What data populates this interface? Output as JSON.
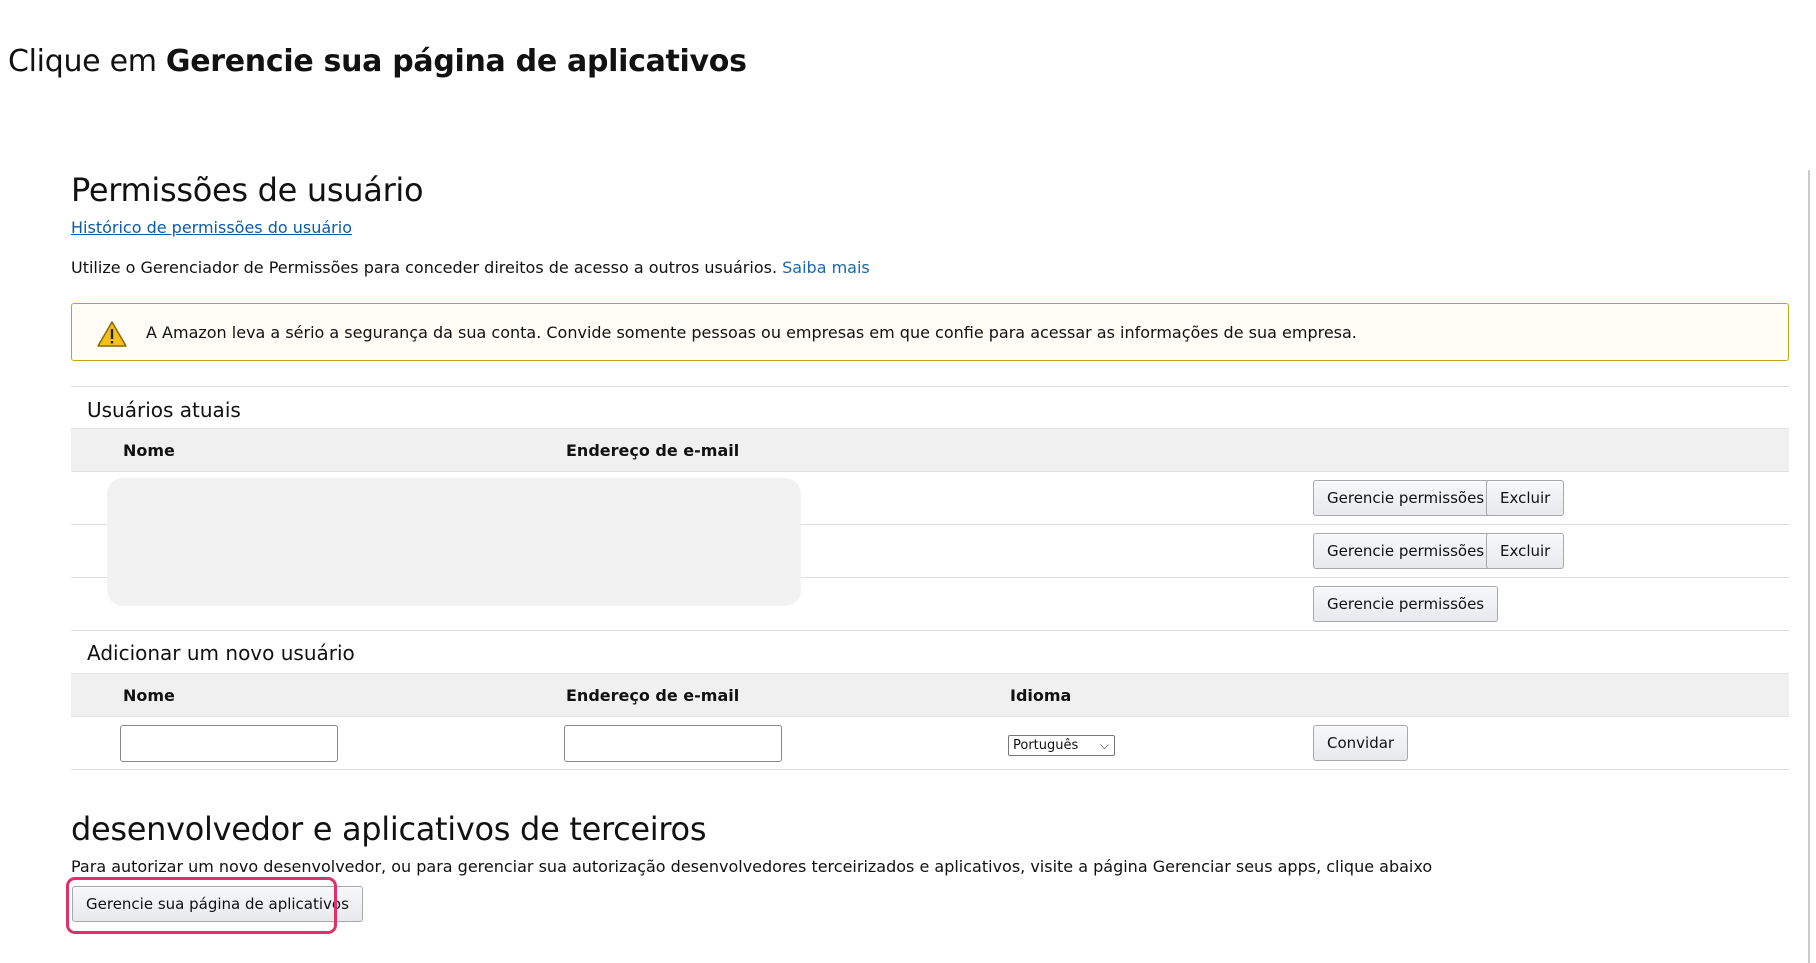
{
  "instruction": {
    "prefix": "Clique em ",
    "bold": "Gerencie sua página de aplicativos"
  },
  "page": {
    "title": "Permissões de usuário",
    "history_link": "Histórico de permissões do usuário",
    "intro_text": "Utilize o Gerenciador de Permissões para conceder direitos de acesso a outros usuários.",
    "intro_link": "Saiba mais"
  },
  "alert": {
    "icon": "warning-icon",
    "text": "A Amazon leva a sério a segurança da sua conta. Convide somente pessoas ou empresas em que confie para acessar as informações de sua empresa."
  },
  "current_users": {
    "title": "Usuários atuais",
    "columns": [
      "Nome",
      "Endereço de e-mail"
    ],
    "rows": [
      {
        "manage": "Gerencie permissões",
        "delete": "Excluir"
      },
      {
        "manage": "Gerencie permissões",
        "delete": "Excluir"
      },
      {
        "manage": "Gerencie permissões"
      }
    ]
  },
  "add_user": {
    "title": "Adicionar um novo usuário",
    "columns": [
      "Nome",
      "Endereço de e-mail",
      "Idioma"
    ],
    "name_value": "",
    "email_value": "",
    "language_selected": "Português",
    "invite_label": "Convidar"
  },
  "developer": {
    "title": "desenvolvedor e aplicativos de terceiros",
    "description": "Para autorizar um novo desenvolvedor, ou para gerenciar sua autorização desenvolvedores terceirizados e aplicativos, visite a página Gerenciar seus apps, clique abaixo",
    "button_label": "Gerencie sua página de aplicativos"
  },
  "colors": {
    "link": "#0b5cab",
    "alert_border": "#c8a11a",
    "highlight": "#e0306a",
    "header_bg": "#f0f0f0"
  }
}
